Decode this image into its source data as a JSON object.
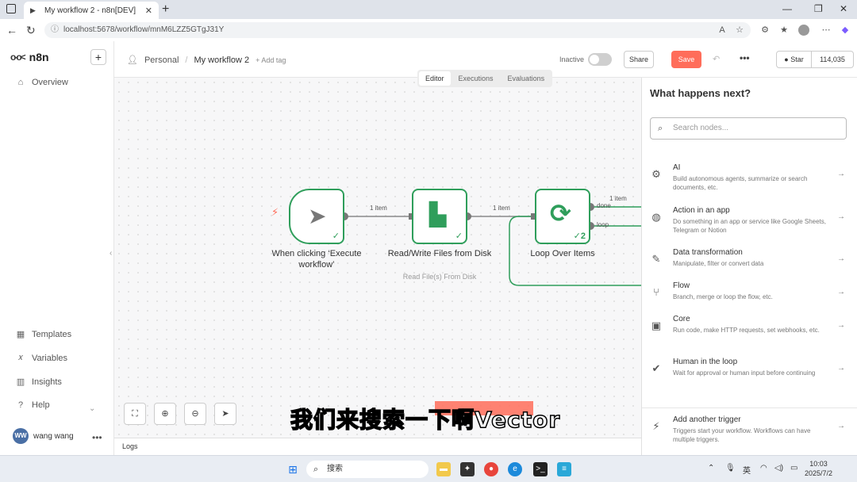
{
  "browser": {
    "tab_title": "My workflow 2 - n8n[DEV]",
    "url": "localhost:5678/workflow/mnM6LZZ5GTgJ31Y"
  },
  "sidebar": {
    "logo": "n8n",
    "items": [
      {
        "label": "Overview",
        "icon": "home-icon"
      },
      {
        "label": "Templates",
        "icon": "templates-icon"
      },
      {
        "label": "Variables",
        "icon": "variables-icon"
      },
      {
        "label": "Insights",
        "icon": "insights-icon"
      },
      {
        "label": "Help",
        "icon": "help-icon"
      }
    ],
    "user": {
      "initials": "WW",
      "name": "wang wang"
    }
  },
  "header": {
    "project": "Personal",
    "workflow_name": "My workflow 2",
    "add_tag": "+ Add tag",
    "inactive_label": "Inactive",
    "share_label": "Share",
    "save_label": "Save",
    "star_label": "Star",
    "star_count": "114,035"
  },
  "canvas": {
    "tabs": [
      "Editor",
      "Executions",
      "Evaluations"
    ],
    "active_tab": "Editor",
    "nodes": [
      {
        "label": "When clicking ‘Execute workflow’",
        "sub": ""
      },
      {
        "label": "Read/Write Files from Disk",
        "sub": "Read File(s) From Disk"
      },
      {
        "label": "Loop Over Items",
        "sub": "",
        "badge": "2"
      }
    ],
    "connection_labels": [
      "1 item",
      "1 item",
      "1 item"
    ],
    "loop_outputs": [
      "done",
      "loop"
    ],
    "logs_label": "Logs",
    "subtitle": "我们来搜索一下啊Vector"
  },
  "panel": {
    "title": "What happens next?",
    "search_placeholder": "Search nodes...",
    "items": [
      {
        "title": "AI",
        "desc": "Build autonomous agents, summarize or search documents, etc.",
        "icon": "robot-icon"
      },
      {
        "title": "Action in an app",
        "desc": "Do something in an app or service like Google Sheets, Telegram or Notion",
        "icon": "globe-icon"
      },
      {
        "title": "Data transformation",
        "desc": "Manipulate, filter or convert data",
        "icon": "pen-icon"
      },
      {
        "title": "Flow",
        "desc": "Branch, merge or loop the flow, etc.",
        "icon": "branch-icon"
      },
      {
        "title": "Core",
        "desc": "Run code, make HTTP requests, set webhooks, etc.",
        "icon": "toolbox-icon"
      },
      {
        "title": "Human in the loop",
        "desc": "Wait for approval or human input before continuing",
        "icon": "user-check-icon"
      },
      {
        "title": "Add another trigger",
        "desc": "Triggers start your workflow. Workflows can have multiple triggers.",
        "icon": "bolt-icon"
      }
    ]
  },
  "taskbar": {
    "search_text": "搜索",
    "ime": "英",
    "time": "10:03",
    "date": "2025/7/2"
  }
}
